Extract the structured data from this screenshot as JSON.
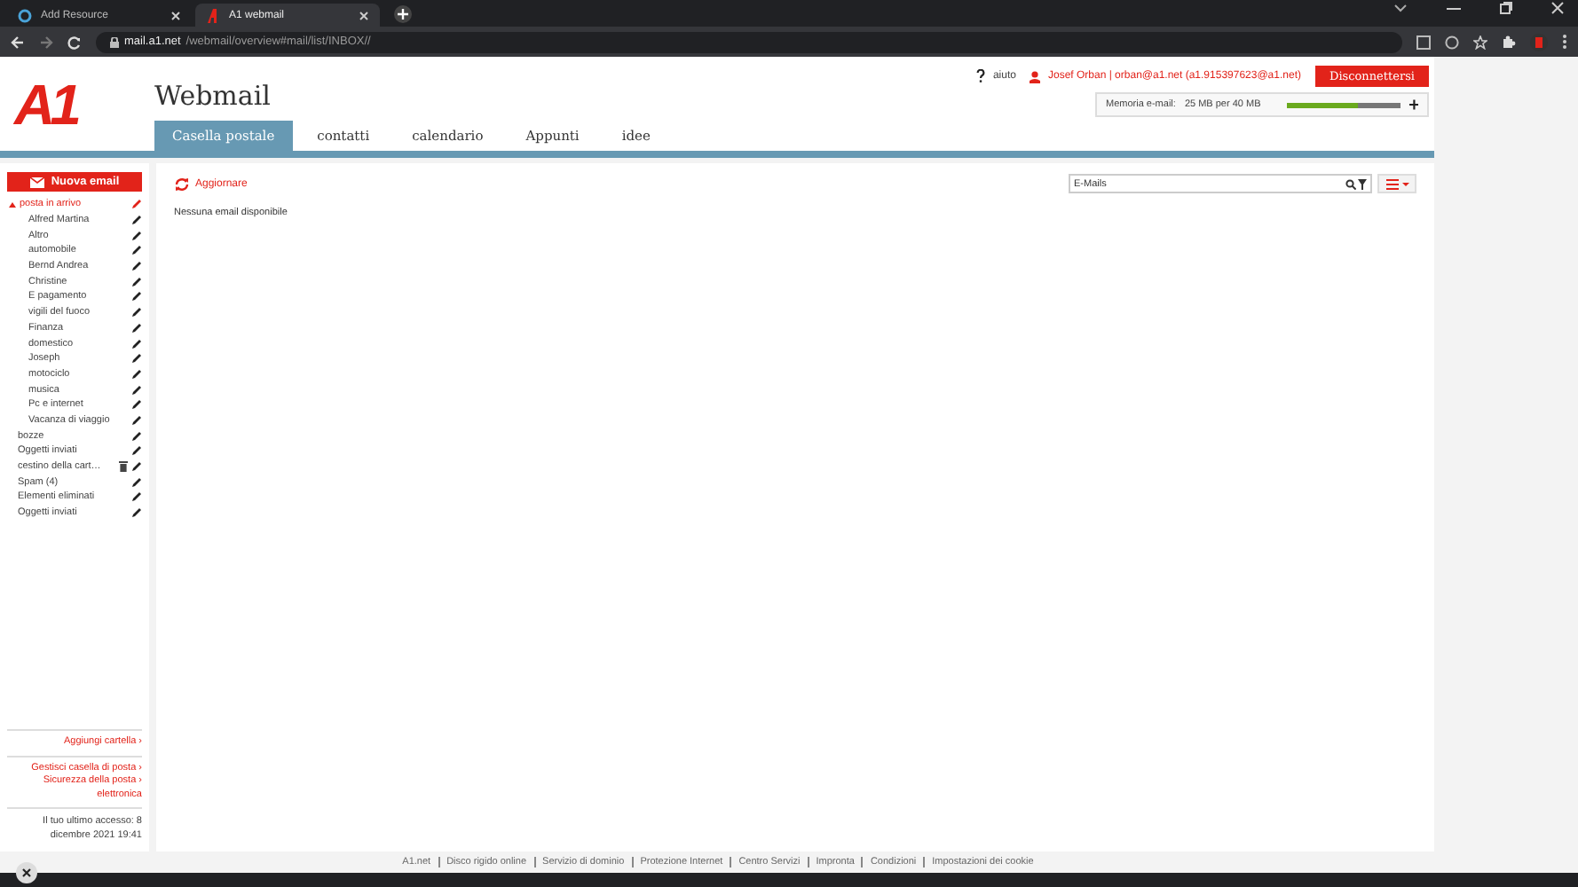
{
  "browser": {
    "tabs": [
      {
        "title": "Add Resource",
        "selected": false
      },
      {
        "title": "A1 webmail",
        "selected": true
      }
    ],
    "url_host": "mail.a1.net",
    "url_path": "/webmail/overview#mail/list/INBOX//"
  },
  "logo": "A1",
  "app_title": "Webmail",
  "nav_tabs": [
    {
      "label": "Casella postale",
      "selected": true
    },
    {
      "label": "contatti",
      "selected": false
    },
    {
      "label": "calendario",
      "selected": false
    },
    {
      "label": "Appunti",
      "selected": false
    },
    {
      "label": "idee",
      "selected": false
    }
  ],
  "help": "aiuto",
  "user": "Josef Orban | orban@a1.net (a1.915397623@a1.net)",
  "logout": "Disconnettersi",
  "storage": {
    "label": "Memoria e-mail:",
    "reading": "25 MB per 40 MB",
    "level": 0.62
  },
  "new_email": "Nuova email",
  "folders": [
    {
      "name": "posta in arrivo",
      "kind": "folder",
      "selected": true,
      "expanded": true,
      "children": [
        {
          "name": "Alfred Martina",
          "kind": "folder",
          "selected": false
        },
        {
          "name": "Altro",
          "kind": "folder",
          "selected": false
        },
        {
          "name": "automobile",
          "kind": "folder",
          "selected": false
        },
        {
          "name": "Bernd Andrea",
          "kind": "folder",
          "selected": false
        },
        {
          "name": "Christine",
          "kind": "folder",
          "selected": false
        },
        {
          "name": "E pagamento",
          "kind": "folder",
          "selected": false
        },
        {
          "name": "vigili del fuoco",
          "kind": "folder",
          "selected": false
        },
        {
          "name": "Finanza",
          "kind": "folder",
          "selected": false
        },
        {
          "name": "domestico",
          "kind": "folder",
          "selected": false
        },
        {
          "name": "Joseph",
          "kind": "folder",
          "selected": false
        },
        {
          "name": "motociclo",
          "kind": "folder",
          "selected": false
        },
        {
          "name": "musica",
          "kind": "folder",
          "selected": false
        },
        {
          "name": "Pc e internet",
          "kind": "folder",
          "selected": false
        },
        {
          "name": "Vacanza di viaggio",
          "kind": "folder",
          "selected": false
        }
      ]
    },
    {
      "name": "bozze",
      "kind": "folder",
      "selected": false
    },
    {
      "name": "Oggetti inviati",
      "kind": "folder",
      "selected": false
    },
    {
      "name": "cestino della cart…",
      "kind": "trash",
      "selected": false
    },
    {
      "name": "Spam (4)",
      "kind": "folder",
      "selected": false
    },
    {
      "name": "Elementi eliminati",
      "kind": "folder",
      "selected": false
    },
    {
      "name": "Oggetti inviati",
      "kind": "folder",
      "selected": false
    }
  ],
  "add_folder": "Aggiungi cartella ›",
  "side_links": [
    "Gestisci casella di posta ›",
    "Sicurezza della posta › elettronica"
  ],
  "last_access": "Il tuo ultimo accesso: 8 dicembre 2021 19:41",
  "refresh": "Aggiornare",
  "search": {
    "value": "E-Mails"
  },
  "empty_message": "Nessuna email disponibile",
  "footer_links": [
    "A1.net",
    "Disco rigido online",
    "Servizio di dominio",
    "Protezione Internet",
    "Centro Servizi",
    "Impronta",
    "Condizioni",
    "Impostazioni dei cookie"
  ]
}
